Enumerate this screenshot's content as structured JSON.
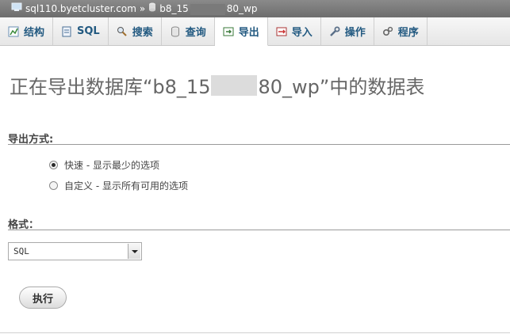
{
  "breadcrumb": {
    "server": "sql110.byetcluster.com",
    "separator": "»",
    "db_prefix": "b8_15",
    "db_suffix": "80_wp"
  },
  "tabs": [
    {
      "label": "结构",
      "icon": "structure-icon"
    },
    {
      "label": "SQL",
      "icon": "sql-icon"
    },
    {
      "label": "搜索",
      "icon": "search-icon"
    },
    {
      "label": "查询",
      "icon": "query-icon"
    },
    {
      "label": "导出",
      "icon": "export-icon",
      "active": true
    },
    {
      "label": "导入",
      "icon": "import-icon"
    },
    {
      "label": "操作",
      "icon": "operations-icon"
    },
    {
      "label": "程序",
      "icon": "routines-icon"
    }
  ],
  "page": {
    "title_prefix": "正在导出数据库“b8_15",
    "title_suffix": "80_wp”中的数据表"
  },
  "export_method": {
    "heading": "导出方式:",
    "options": [
      {
        "label": "快速 - 显示最少的选项",
        "selected": true
      },
      {
        "label": "自定义 - 显示所有可用的选项",
        "selected": false
      }
    ]
  },
  "format": {
    "heading": "格式：",
    "selected": "SQL"
  },
  "go_button": "执行",
  "colors": {
    "tab_text": "#235a81",
    "title": "#666666",
    "crumbbar": "#7a7a7a"
  }
}
